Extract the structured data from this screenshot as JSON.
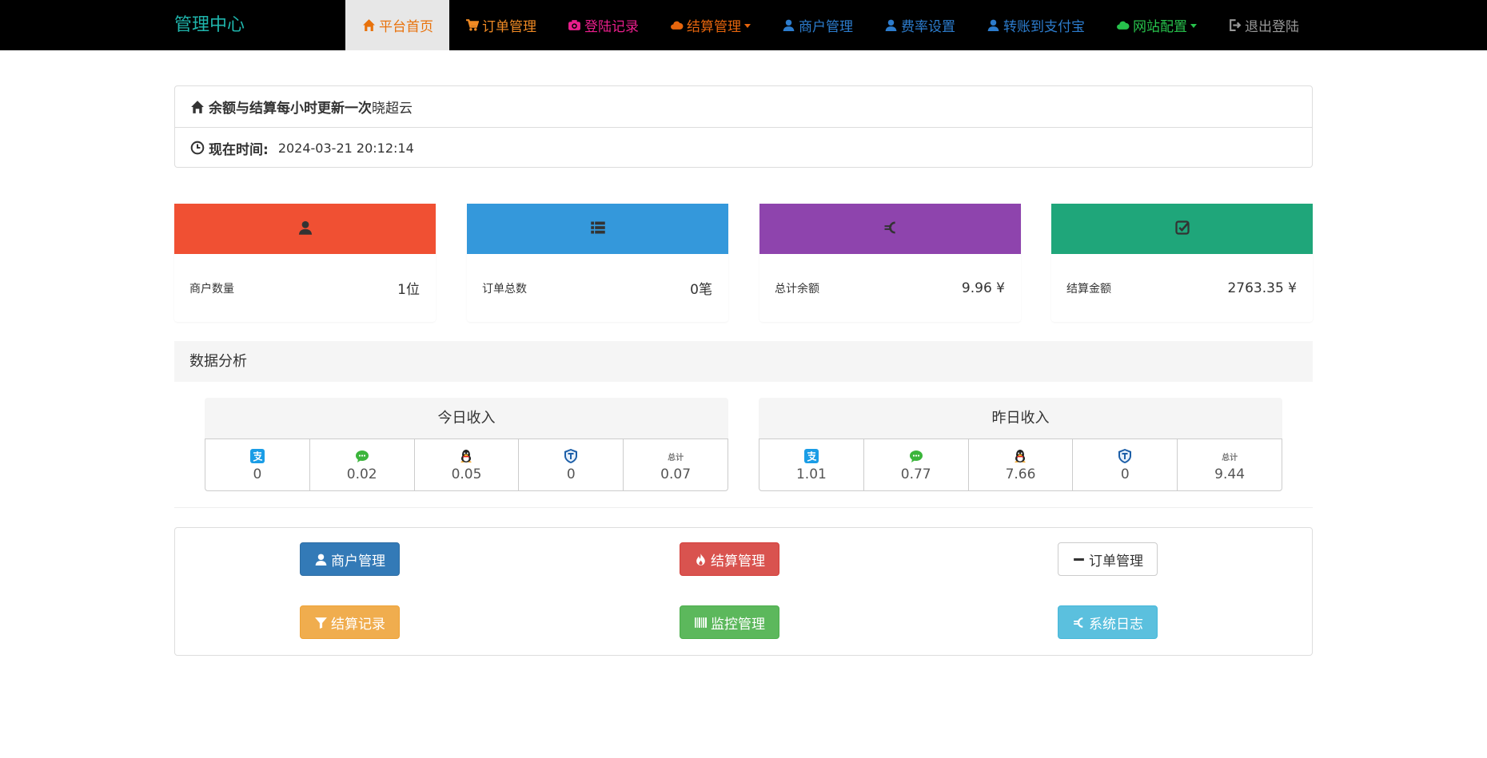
{
  "navbar": {
    "brand": "管理中心",
    "items": [
      {
        "label": "平台首页",
        "color": "#e8720c"
      },
      {
        "label": "订单管理",
        "color": "#f08a24"
      },
      {
        "label": "登陆记录",
        "color": "#ea1e8c"
      },
      {
        "label": "结算管理",
        "color": "#e6650d"
      },
      {
        "label": "商户管理",
        "color": "#2c7ccd"
      },
      {
        "label": "费率设置",
        "color": "#2c7ccd"
      },
      {
        "label": "转账到支付宝",
        "color": "#2c7ccd"
      },
      {
        "label": "网站配置",
        "color": "#27c24c"
      },
      {
        "label": "退出登陆",
        "color": "#999999"
      }
    ]
  },
  "info": {
    "notice_bold": "余额与结算每小时更新一次",
    "notice_extra": "晓超云",
    "time_label": "现在时间:",
    "time_value": "2024-03-21 20:12:14"
  },
  "stats": [
    {
      "label": "商户数量",
      "value": "1位",
      "color": "#f05033",
      "icon": "user-icon"
    },
    {
      "label": "订单总数",
      "value": "0笔",
      "color": "#3498db",
      "icon": "list-icon"
    },
    {
      "label": "总计余额",
      "value": "9.96 ¥",
      "color": "#8e44ad",
      "icon": "euro-icon"
    },
    {
      "label": "结算金额",
      "value": "2763.35 ¥",
      "color": "#1fa67a",
      "icon": "check-icon"
    }
  ],
  "analysis": {
    "title": "数据分析",
    "today": {
      "title": "今日收入",
      "total_label": "总计",
      "values": [
        "0",
        "0.02",
        "0.05",
        "0",
        "0.07"
      ]
    },
    "yesterday": {
      "title": "昨日收入",
      "total_label": "总计",
      "values": [
        "1.01",
        "0.77",
        "7.66",
        "0",
        "9.44"
      ]
    }
  },
  "actions": {
    "merchant": "商户管理",
    "settlement": "结算管理",
    "orders": "订单管理",
    "settle_record": "结算记录",
    "monitor": "监控管理",
    "syslog": "系统日志"
  }
}
